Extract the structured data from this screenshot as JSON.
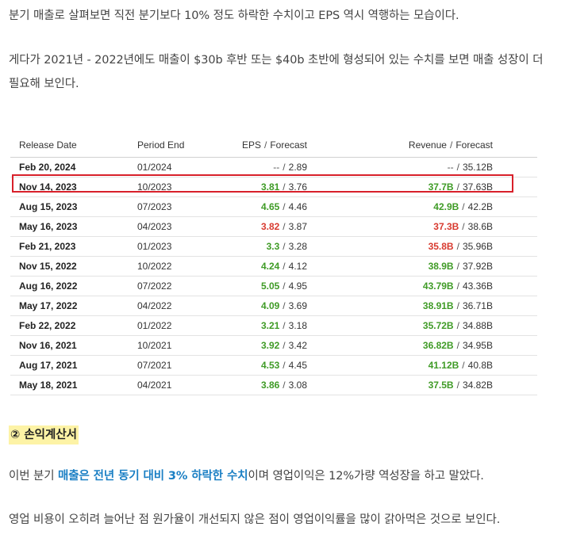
{
  "paragraphs": {
    "p1": "분기 매출로 살펴보면 직전 분기보다 10% 정도 하락한 수치이고 EPS 역시 역행하는 모습이다.",
    "p2": "게다가 2021년 - 2022년에도 매출이 $30b 후반 또는 $40b 초반에 형성되어 있는 수치를 보면 매출 성장이 더 필요해 보인다.",
    "p3_pre": "이번 분기 ",
    "p3_hl": "매출은 전년 동기 대비 3% 하락한 수치",
    "p3_post": "이며 영업이익은 12%가량 역성장을 하고 말았다.",
    "p4": "영업 비용이 오히려 늘어난 점 원가율이 개선되지 않은 점이 영업이익률을 많이 갉아먹은 것으로 보인다."
  },
  "section_heading": "② 손익계산서",
  "table": {
    "headers": {
      "release_date": "Release Date",
      "period_end": "Period End",
      "eps": "EPS",
      "eps_forecast": "Forecast",
      "revenue": "Revenue",
      "revenue_forecast": "Forecast",
      "separator": "/"
    },
    "highlight_color": "#d8202a",
    "colors": {
      "beat": "#3f9b26",
      "miss": "#d83a2f"
    },
    "rows": [
      {
        "release_date": "Feb 20, 2024",
        "period_end": "01/2024",
        "eps": "--",
        "eps_status": "none",
        "eps_forecast": "2.89",
        "revenue": "--",
        "revenue_status": "none",
        "revenue_forecast": "35.12B"
      },
      {
        "release_date": "Nov 14, 2023",
        "period_end": "10/2023",
        "eps": "3.81",
        "eps_status": "beat",
        "eps_forecast": "3.76",
        "revenue": "37.7B",
        "revenue_status": "beat",
        "revenue_forecast": "37.63B",
        "highlighted": true
      },
      {
        "release_date": "Aug 15, 2023",
        "period_end": "07/2023",
        "eps": "4.65",
        "eps_status": "beat",
        "eps_forecast": "4.46",
        "revenue": "42.9B",
        "revenue_status": "beat",
        "revenue_forecast": "42.2B"
      },
      {
        "release_date": "May 16, 2023",
        "period_end": "04/2023",
        "eps": "3.82",
        "eps_status": "miss",
        "eps_forecast": "3.87",
        "revenue": "37.3B",
        "revenue_status": "miss",
        "revenue_forecast": "38.6B"
      },
      {
        "release_date": "Feb 21, 2023",
        "period_end": "01/2023",
        "eps": "3.3",
        "eps_status": "beat",
        "eps_forecast": "3.28",
        "revenue": "35.8B",
        "revenue_status": "miss",
        "revenue_forecast": "35.96B"
      },
      {
        "release_date": "Nov 15, 2022",
        "period_end": "10/2022",
        "eps": "4.24",
        "eps_status": "beat",
        "eps_forecast": "4.12",
        "revenue": "38.9B",
        "revenue_status": "beat",
        "revenue_forecast": "37.92B"
      },
      {
        "release_date": "Aug 16, 2022",
        "period_end": "07/2022",
        "eps": "5.05",
        "eps_status": "beat",
        "eps_forecast": "4.95",
        "revenue": "43.79B",
        "revenue_status": "beat",
        "revenue_forecast": "43.36B"
      },
      {
        "release_date": "May 17, 2022",
        "period_end": "04/2022",
        "eps": "4.09",
        "eps_status": "beat",
        "eps_forecast": "3.69",
        "revenue": "38.91B",
        "revenue_status": "beat",
        "revenue_forecast": "36.71B"
      },
      {
        "release_date": "Feb 22, 2022",
        "period_end": "01/2022",
        "eps": "3.21",
        "eps_status": "beat",
        "eps_forecast": "3.18",
        "revenue": "35.72B",
        "revenue_status": "beat",
        "revenue_forecast": "34.88B"
      },
      {
        "release_date": "Nov 16, 2021",
        "period_end": "10/2021",
        "eps": "3.92",
        "eps_status": "beat",
        "eps_forecast": "3.42",
        "revenue": "36.82B",
        "revenue_status": "beat",
        "revenue_forecast": "34.95B"
      },
      {
        "release_date": "Aug 17, 2021",
        "period_end": "07/2021",
        "eps": "4.53",
        "eps_status": "beat",
        "eps_forecast": "4.45",
        "revenue": "41.12B",
        "revenue_status": "beat",
        "revenue_forecast": "40.8B"
      },
      {
        "release_date": "May 18, 2021",
        "period_end": "04/2021",
        "eps": "3.86",
        "eps_status": "beat",
        "eps_forecast": "3.08",
        "revenue": "37.5B",
        "revenue_status": "beat",
        "revenue_forecast": "34.82B"
      }
    ]
  }
}
